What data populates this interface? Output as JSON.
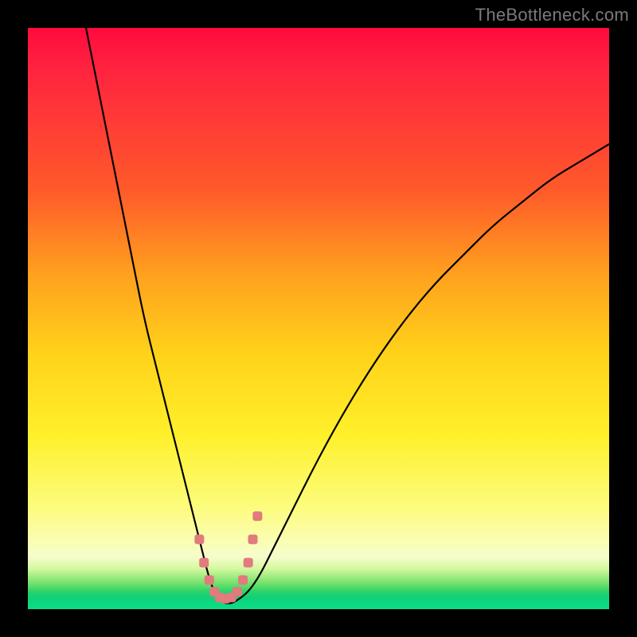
{
  "watermark": "TheBottleneck.com",
  "chart_data": {
    "type": "line",
    "title": "",
    "xlabel": "",
    "ylabel": "",
    "xlim": [
      0,
      100
    ],
    "ylim": [
      0,
      100
    ],
    "grid": false,
    "legend": false,
    "background_gradient": {
      "direction": "top-to-bottom",
      "stops": [
        {
          "pos": 0,
          "color": "#ff0a3e"
        },
        {
          "pos": 28,
          "color": "#ff5a2a"
        },
        {
          "pos": 56,
          "color": "#ffd21a"
        },
        {
          "pos": 82,
          "color": "#fcfc7a"
        },
        {
          "pos": 95,
          "color": "#75e26b"
        },
        {
          "pos": 100,
          "color": "#0adf86"
        }
      ]
    },
    "series": [
      {
        "name": "bottleneck-curve",
        "color": "#000000",
        "x": [
          10,
          12,
          14,
          16,
          18,
          20,
          22,
          24,
          26,
          28,
          30,
          31,
          32,
          33,
          34,
          35,
          36,
          38,
          40,
          42,
          45,
          50,
          55,
          60,
          65,
          70,
          75,
          80,
          85,
          90,
          95,
          100
        ],
        "y": [
          100,
          90,
          80,
          70,
          60,
          50,
          42,
          34,
          26,
          18,
          10,
          6,
          3,
          1.5,
          1,
          1,
          1.5,
          3,
          6,
          10,
          16,
          26,
          35,
          43,
          50,
          56,
          61,
          66,
          70,
          74,
          77,
          80
        ]
      },
      {
        "name": "optimal-zone-marker",
        "color": "#e17b7e",
        "type": "scatter",
        "x": [
          29.5,
          30.3,
          31.2,
          32.1,
          33.0,
          34.0,
          35.0,
          36.0,
          37.0,
          37.9,
          38.7,
          39.5
        ],
        "y": [
          12,
          8,
          5,
          3,
          2,
          1.8,
          2,
          3,
          5,
          8,
          12,
          16
        ]
      }
    ],
    "optimal_x": 34
  }
}
